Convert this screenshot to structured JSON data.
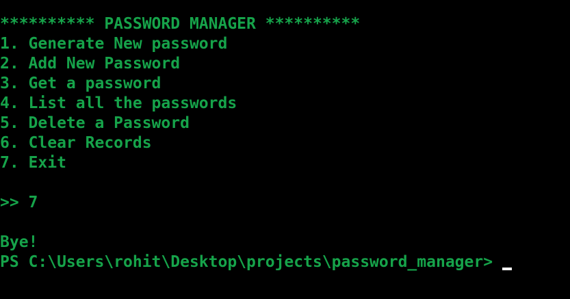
{
  "terminal": {
    "title_line": "********** PASSWORD MANAGER **********",
    "menu": [
      "1. Generate New password",
      "2. Add New Password",
      "3. Get a password",
      "4. List all the passwords",
      "5. Delete a Password",
      "6. Clear Records",
      "7. Exit"
    ],
    "input_line": ">> 7",
    "output_line": "Bye!",
    "prompt": "PS C:\\Users\\rohit\\Desktop\\projects\\password_manager>"
  },
  "colors": {
    "background": "#000000",
    "text": "#16a34a",
    "cursor": "#ffffff"
  }
}
